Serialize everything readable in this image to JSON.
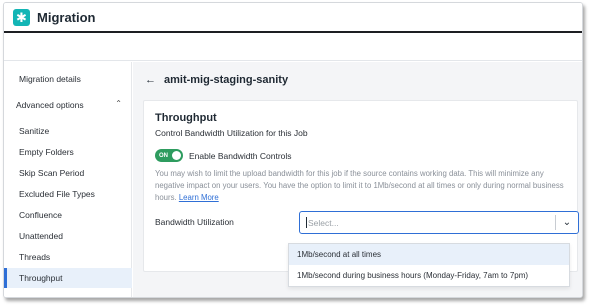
{
  "app": {
    "title": "Migration",
    "logo_glyph": "✱",
    "accent": "#12b5b5"
  },
  "sidebar": {
    "items": [
      {
        "label": "Migration details"
      },
      {
        "label": "Advanced options",
        "expanded": true
      },
      {
        "label": "Sanitize"
      },
      {
        "label": "Empty Folders"
      },
      {
        "label": "Skip Scan Period"
      },
      {
        "label": "Excluded File Types"
      },
      {
        "label": "Confluence"
      },
      {
        "label": "Unattended"
      },
      {
        "label": "Threads"
      },
      {
        "label": "Throughput",
        "active": true
      }
    ]
  },
  "main": {
    "breadcrumb": "amit-mig-staging-sanity",
    "card": {
      "title": "Throughput",
      "subtitle": "Control Bandwidth Utilization for this Job",
      "toggle": {
        "state": "ON",
        "label": "Enable Bandwidth Controls",
        "color": "#2e9c5f"
      },
      "description": "You may wish to limit the upload bandwidth for this job if the source contains working data. This will minimize any negative impact on your users. You have the option to limit it to 1Mb/second at all times or only during normal business hours.",
      "learn_more": "Learn More",
      "field_label": "Bandwidth Utilization",
      "select_placeholder": "Select...",
      "options": [
        "1Mb/second at all times",
        "1Mb/second during business hours (Monday-Friday, 7am to 7pm)"
      ]
    }
  }
}
